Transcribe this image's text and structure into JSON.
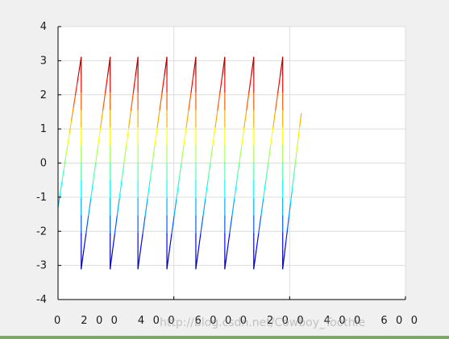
{
  "chart_data": {
    "type": "line",
    "title": "",
    "xlabel": "",
    "ylabel": "",
    "xlim": [
      0,
      600
    ],
    "ylim": [
      -4,
      4
    ],
    "xticks": [
      0,
      200,
      400,
      600
    ],
    "yticks": [
      -4,
      -3,
      -2,
      -1,
      0,
      1,
      2,
      3,
      4
    ],
    "grid": true,
    "colormap": "jet",
    "color_range": [
      -3.14,
      3.14
    ],
    "series": [
      {
        "pattern": "sawtooth",
        "x_start": 0,
        "y_start": -1.3,
        "x_end": 420,
        "y_end": 1.45,
        "y_low": -3.1,
        "y_high": 3.1,
        "wrap_x": [
          40,
          90,
          138,
          188,
          238,
          288,
          338,
          388
        ]
      }
    ]
  },
  "overlay": {
    "tick_row_text": "0   200   400   6000   200   400   600"
  },
  "watermark": {
    "text": "http://blog.csdn.net/Cowboy_Toothie"
  },
  "colors": {
    "axes_background": "#ffffff",
    "figure_background": "#f0f0f0",
    "grid": "#dcdcdc",
    "axis": "#000000"
  }
}
